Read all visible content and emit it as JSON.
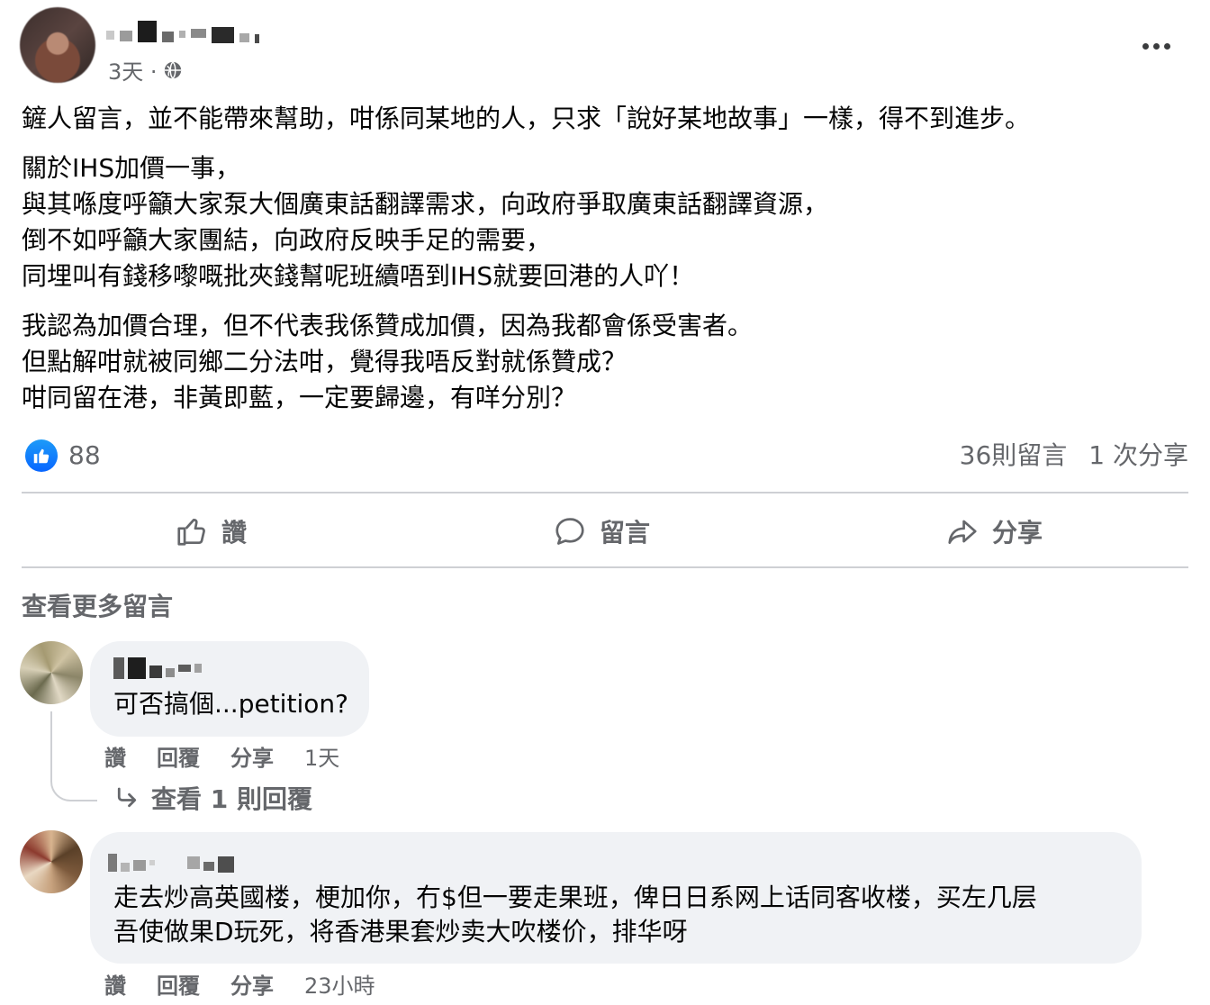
{
  "post": {
    "time": "3天 ·",
    "paragraphs": [
      [
        "鏟人留言，並不能帶來幫助，咁係同某地的人，只求「說好某地故事」一樣，得不到進步。"
      ],
      [
        "關於IHS加價一事，",
        "與其喺度呼籲大家泵大個廣東話翻譯需求，向政府爭取廣東話翻譯資源，",
        "倒不如呼籲大家團結，向政府反映手足的需要，",
        "同埋叫有錢移嚟嘅批夾錢幫呢班續唔到IHS就要回港的人吖！"
      ],
      [
        "我認為加價合理，但不代表我係贊成加價，因為我都會係受害者。",
        "但點解咁就被同鄉二分法咁，覺得我唔反對就係贊成？",
        "咁同留在港，非黃即藍，一定要歸邊，有咩分別？"
      ]
    ],
    "like_count": "88",
    "comment_count": "36則留言",
    "share_count": "1 次分享"
  },
  "actions": {
    "like": "讚",
    "comment": "留言",
    "share": "分享"
  },
  "more_comments": "查看更多留言",
  "comments": [
    {
      "text": "可否搞個...petition?",
      "like": "讚",
      "reply": "回覆",
      "share": "分享",
      "time": "1天",
      "replies": "查看 1 則回覆"
    },
    {
      "text_lines": [
        "走去炒高英國楼，梗加你，冇$但一要走果班，俾日日系网上话同客收楼，买左几层",
        "吾使做果D玩死，将香港果套炒卖大吹楼价，排华呀"
      ],
      "like": "讚",
      "reply": "回覆",
      "share": "分享",
      "time": "23小時"
    }
  ],
  "colors": {
    "secondary_text": "#65676b",
    "like_blue": "#0866ff",
    "bubble_bg": "#f0f2f5",
    "divider": "#ced0d4"
  }
}
